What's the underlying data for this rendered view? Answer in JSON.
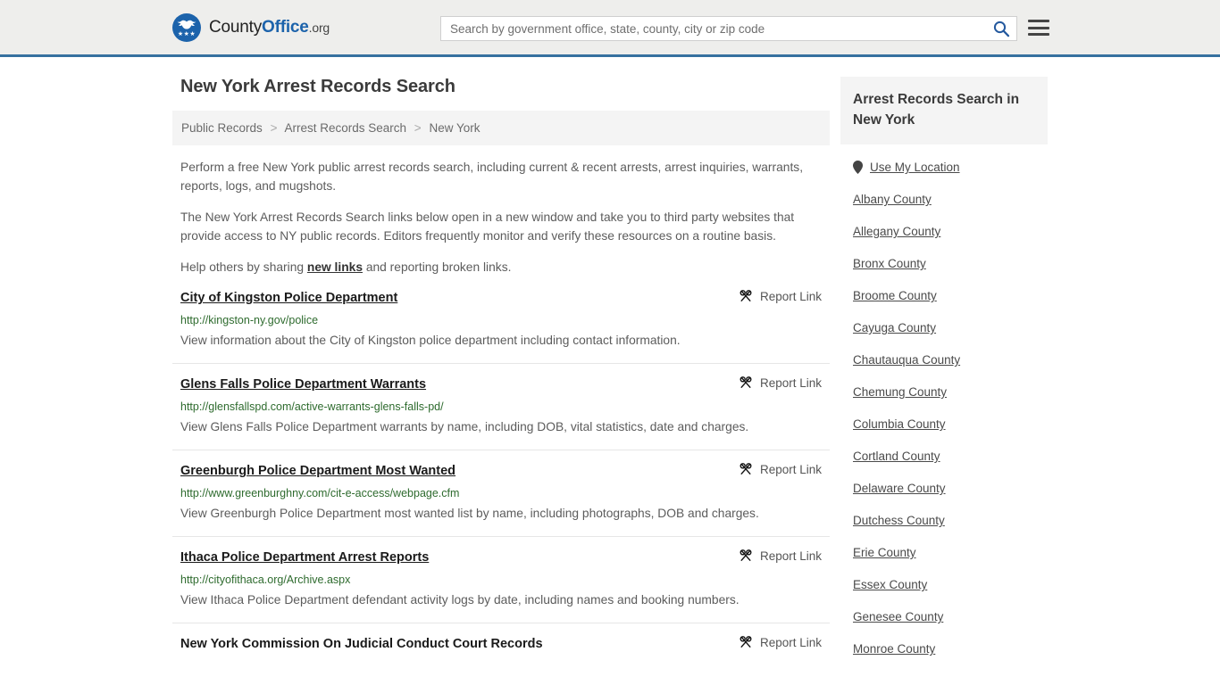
{
  "header": {
    "brand": {
      "county": "County",
      "office": "Office",
      "org": ".org",
      "icon": "eagle-seal-icon",
      "stars": "★★★"
    },
    "search": {
      "placeholder": "Search by government office, state, county, city or zip code",
      "value": "",
      "search_icon": "search-icon"
    },
    "menu_icon": "hamburger-menu-icon",
    "accent_color": "#36709f",
    "brand_blue": "#1c63ab"
  },
  "page": {
    "title": "New York Arrest Records Search"
  },
  "breadcrumb": {
    "items": [
      {
        "label": "Public Records"
      },
      {
        "label": "Arrest Records Search"
      },
      {
        "label": "New York"
      }
    ],
    "separator": ">"
  },
  "intro": {
    "p1": "Perform a free New York public arrest records search, including current & recent arrests, arrest inquiries, warrants, reports, logs, and mugshots.",
    "p2": "The New York Arrest Records Search links below open in a new window and take you to third party websites that provide access to NY public records. Editors frequently monitor and verify these resources on a routine basis.",
    "p3_before": "Help others by sharing ",
    "p3_link": "new links",
    "p3_after": " and reporting broken links."
  },
  "report_link_label": "Report Link",
  "report_link_icon": "broken-link-icon",
  "results": [
    {
      "title": "City of Kingston Police Department",
      "url": "http://kingston-ny.gov/police",
      "description": "View information about the City of Kingston police department including contact information.",
      "report_label": "Report Link"
    },
    {
      "title": "Glens Falls Police Department Warrants",
      "url": "http://glensfallspd.com/active-warrants-glens-falls-pd/",
      "description": "View Glens Falls Police Department warrants by name, including DOB, vital statistics, date and charges.",
      "report_label": "Report Link"
    },
    {
      "title": "Greenburgh Police Department Most Wanted",
      "url": "http://www.greenburghny.com/cit-e-access/webpage.cfm",
      "description": "View Greenburgh Police Department most wanted list by name, including photographs, DOB and charges.",
      "report_label": "Report Link"
    },
    {
      "title": "Ithaca Police Department Arrest Reports",
      "url": "http://cityofithaca.org/Archive.aspx",
      "description": "View Ithaca Police Department defendant activity logs by date, including names and booking numbers.",
      "report_label": "Report Link"
    },
    {
      "title": "New York Commission On Judicial Conduct Court Records",
      "url": "",
      "description": "",
      "report_label": "Report Link"
    }
  ],
  "sidebar": {
    "title": "Arrest Records Search in New York",
    "location_icon": "map-pin-icon",
    "items": [
      {
        "label": "Use My Location",
        "icon": "map-pin-icon"
      },
      {
        "label": "Albany County"
      },
      {
        "label": "Allegany County"
      },
      {
        "label": "Bronx County"
      },
      {
        "label": "Broome County"
      },
      {
        "label": "Cayuga County"
      },
      {
        "label": "Chautauqua County"
      },
      {
        "label": "Chemung County"
      },
      {
        "label": "Columbia County"
      },
      {
        "label": "Cortland County"
      },
      {
        "label": "Delaware County"
      },
      {
        "label": "Dutchess County"
      },
      {
        "label": "Erie County"
      },
      {
        "label": "Essex County"
      },
      {
        "label": "Genesee County"
      },
      {
        "label": "Monroe County"
      }
    ]
  }
}
